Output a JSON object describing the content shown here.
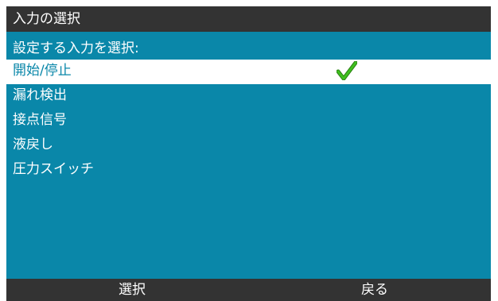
{
  "title": "入力の選択",
  "prompt": "設定する入力を選択:",
  "items": [
    {
      "label": "開始/停止",
      "selected": true
    },
    {
      "label": "漏れ検出",
      "selected": false
    },
    {
      "label": "接点信号",
      "selected": false
    },
    {
      "label": "液戻し",
      "selected": false
    },
    {
      "label": "圧力スイッチ",
      "selected": false
    }
  ],
  "softkeys": {
    "left": "選択",
    "right": "戻る"
  },
  "colors": {
    "background": "#0a87a9",
    "bars": "#333333",
    "check": "#3fbf1f"
  },
  "icons": {
    "check": "checkmark-icon"
  }
}
